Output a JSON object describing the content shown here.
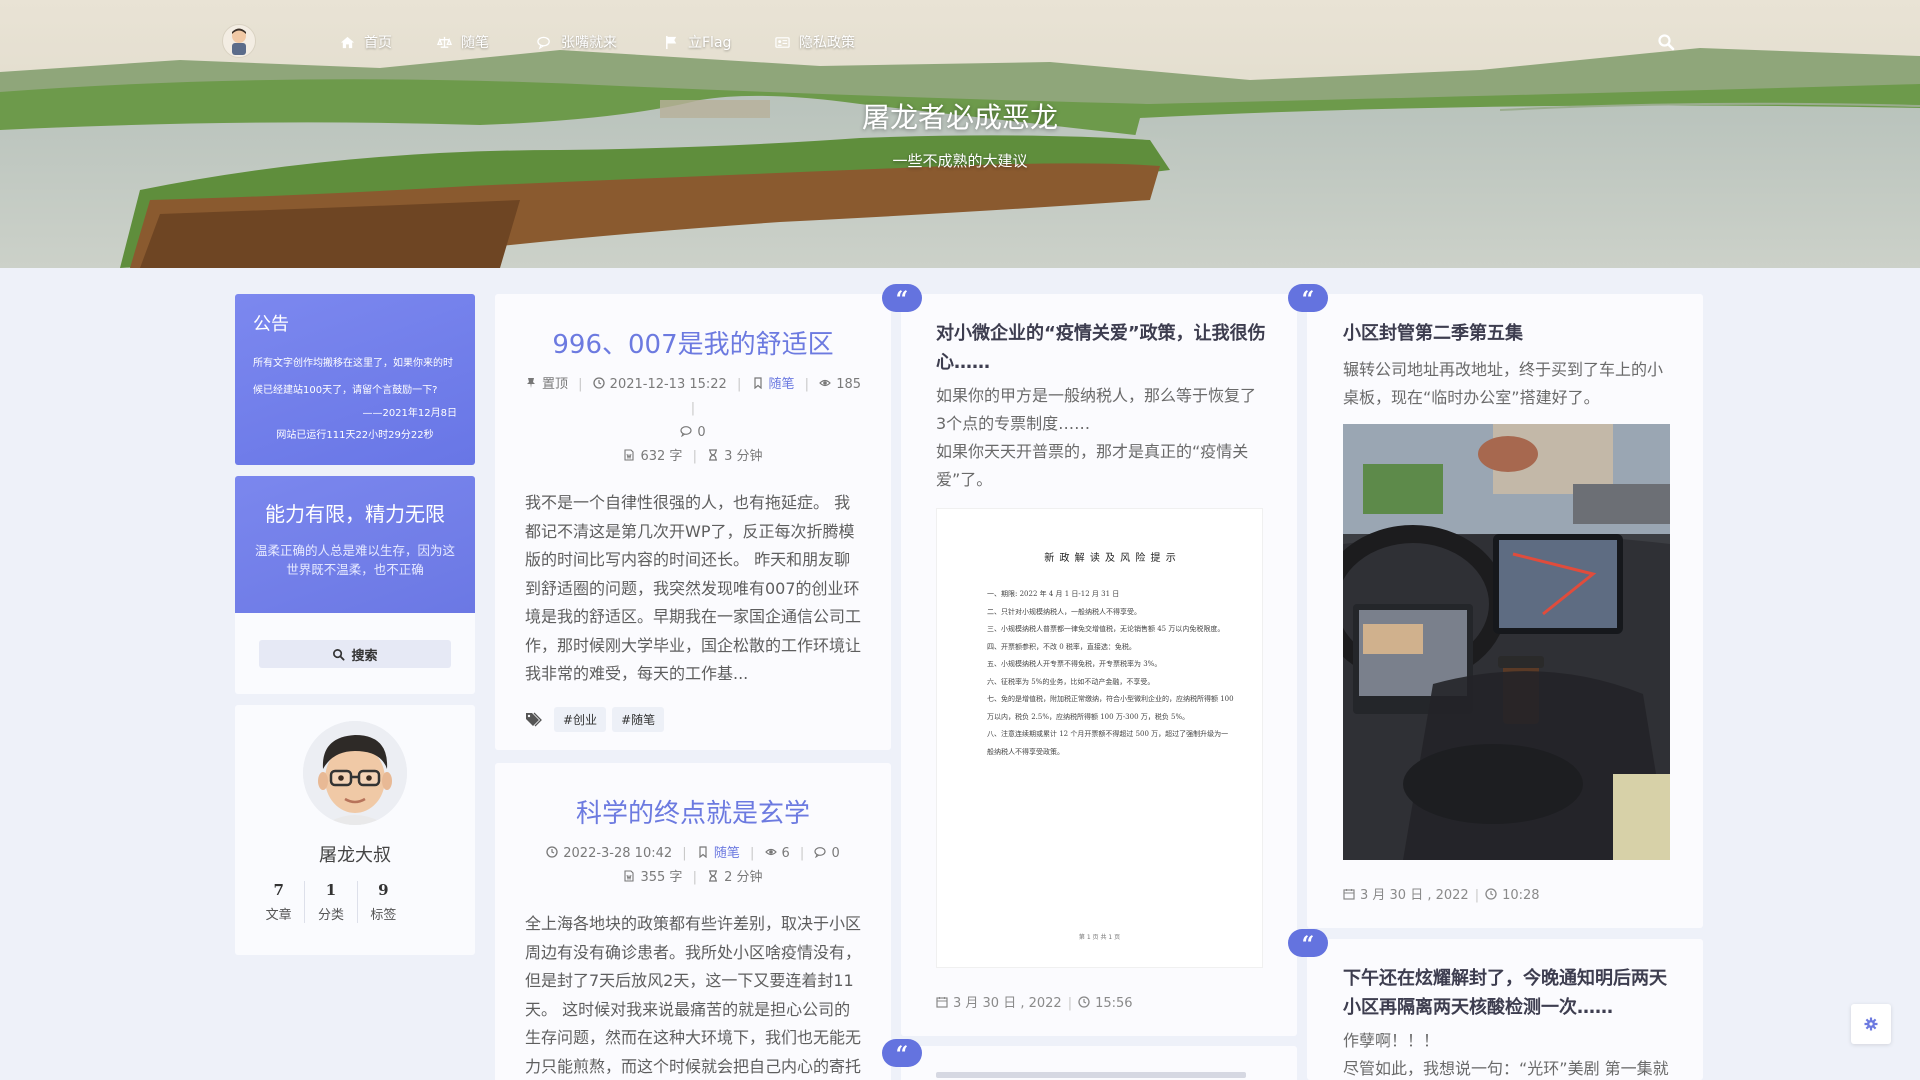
{
  "nav": {
    "items": [
      {
        "label": "首页",
        "icon": "home-icon"
      },
      {
        "label": "随笔",
        "icon": "scale-icon"
      },
      {
        "label": "张嘴就来",
        "icon": "chat-icon"
      },
      {
        "label": "立Flag",
        "icon": "flag-icon"
      },
      {
        "label": "隐私政策",
        "icon": "id-card-icon"
      }
    ]
  },
  "site": {
    "title": "屠龙者必成恶龙",
    "subtitle": "一些不成熟的大建议"
  },
  "sidebar": {
    "notice": {
      "title": "公告",
      "line1": "所有文字创作均搬移在这里了，如果你来的时",
      "line2": "候已经建站100天了，请留个言鼓励一下?",
      "sign": "——2021年12月8日",
      "running": "网站已运行111天22小时29分22秒"
    },
    "motto": {
      "title": "能力有限，精力无限",
      "text": "温柔正确的人总是难以生存，因为这世界既不温柔，也不正确"
    },
    "search_label": "搜索",
    "profile": {
      "name": "屠龙大叔",
      "stats": [
        {
          "num": "7",
          "label": "文章"
        },
        {
          "num": "1",
          "label": "分类"
        },
        {
          "num": "9",
          "label": "标签"
        }
      ]
    }
  },
  "posts": [
    {
      "title": "996、007是我的舒适区",
      "sticky": "置顶",
      "date": "2021-12-13 15:22",
      "category": "随笔",
      "views": "185",
      "comments": "0",
      "words": "632 字",
      "read_time": "3 分钟",
      "excerpt": "我不是一个自律性很强的人，也有拖延症。 我都记不清这是第几次开WP了，反正每次折腾模版的时间比写内容的时间还长。 昨天和朋友聊到舒适圈的问题，我突然发现唯有007的创业环境是我的舒适区。早期我在一家国企通信公司工作，那时候刚大学毕业，国企松散的工作环境让我非常的难受，每天的工作基...",
      "tags": [
        "#创业",
        "#随笔"
      ]
    },
    {
      "title": "科学的终点就是玄学",
      "date": "2022-3-28 10:42",
      "category": "随笔",
      "views": "6",
      "comments": "0",
      "words": "355 字",
      "read_time": "2 分钟",
      "excerpt": "全上海各地块的政策都有些许差别，取决于小区周边有没有确诊患者。我所处小区啥疫情没有，但是封了7天后放风2天，这一下又要连着封11天。 这时候对我来说最痛苦的就是担心公司的生存问题，然而在这种大环境下，我们也无能无力只能煎熬，而这个时候就会把自己内心的寄托"
    }
  ],
  "quotes": [
    {
      "title": "对小微企业的“疫情关爱”政策，让我很伤心……",
      "text1": "如果你的甲方是一般纳税人，那么等于恢复了3个点的专票制度……",
      "text2": "如果你天天开普票的，那才是真正的“疫情关爱”了。",
      "date": "3 月 30 日 , 2022",
      "time": "15:56",
      "doc": {
        "heading": "新 政 解 读 及 风 险 提 示",
        "lines": [
          "一、期限: 2022 年 4 月 1 日-12 月 31 日",
          "二、只针对小规模纳税人，一般纳税人不得享受。",
          "三、小规模纳税人普票都一律免交增值税，无论销售额 45 万以内免税限度。",
          "四、开票额参积，不改 0 税率，直接选：免税。",
          "五、小规模纳税人开专票不得免税，开专票税率为 3%。",
          "六、征税率为 5%的业务，比如不动产金融，不享受。",
          "七、免的是增值税，附加税正常缴纳，符合小型微利企业的，应纳税所得额 100 万以内，税负 2.5%，应纳税所得额 100 万-300 万，税负 5%。",
          "八、注意连续期或累计 12 个月开票额不得超过 500 万，超过了强制升级为一般纳税人不得享受政策。"
        ],
        "page": "第 1 页 共 1 页"
      }
    },
    {
      "title": "小区封管第二季第五集",
      "text": "辗转公司地址再改地址，终于买到了车上的小桌板，现在“临时办公室”搭建好了。",
      "date": "3 月 30 日 , 2022",
      "time": "10:28"
    },
    {
      "title": "下午还在炫耀解封了，今晚通知明后两天小区再隔离两天核酸检测一次……",
      "text1": "作孽啊！！！",
      "text2": "尽管如此，我想说一句：“光环”美剧 第一集就"
    }
  ],
  "colors": {
    "accent": "#6c7ae0",
    "badge": "#6473df",
    "background": "#eef1f9"
  }
}
